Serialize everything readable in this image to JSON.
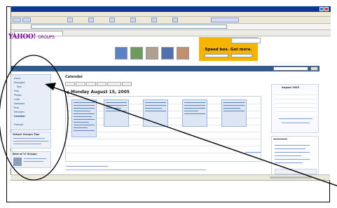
{
  "browser": {
    "title": "",
    "address": "",
    "tab_label": ""
  },
  "brand": {
    "logo": "YAHOO!",
    "logo_suffix": "GROUPS"
  },
  "ad": {
    "line1": "Speed box. Get more.",
    "line2": ""
  },
  "group": {
    "name": ""
  },
  "calendar": {
    "title": "Calendar",
    "date_heading": "Monday August 15, 2005",
    "tabs": [
      "Day",
      "Week",
      "Month",
      "Year",
      "Event List",
      "Tasks"
    ]
  },
  "sidebar": {
    "items": [
      "Home",
      "Messages",
      "Post",
      "Files",
      "Photos",
      "Links",
      "Database",
      "Polls",
      "Members",
      "Calendar",
      "Promote"
    ],
    "box1_title": "Yahoo! Groups Tips",
    "box2_title": "Best of Y! Groups"
  },
  "minical": {
    "title": "August 2005"
  },
  "colors": {
    "brand": "#7b0099",
    "groupbar": "#355a8c",
    "event_fill": "#dde6f4",
    "ad_fill": "#f5b400"
  }
}
